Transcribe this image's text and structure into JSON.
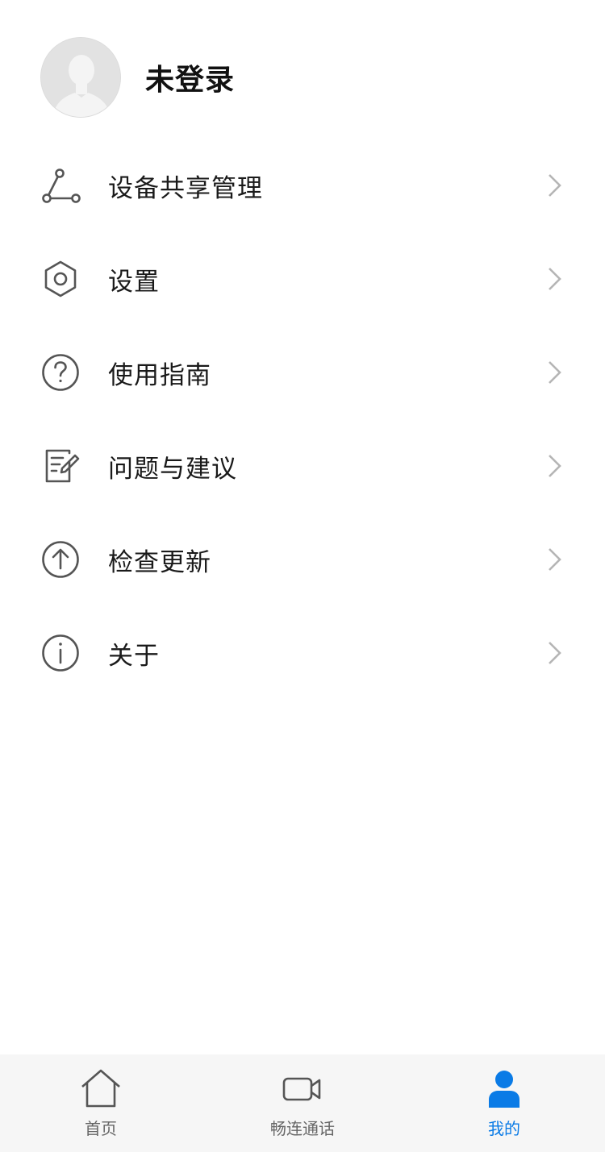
{
  "profile": {
    "name": "未登录",
    "avatar_icon": "default-user-avatar-icon"
  },
  "menu": {
    "items": [
      {
        "label": "设备共享管理",
        "icon": "share-nodes-icon"
      },
      {
        "label": "设置",
        "icon": "gear-icon"
      },
      {
        "label": "使用指南",
        "icon": "help-circle-icon"
      },
      {
        "label": "问题与建议",
        "icon": "feedback-edit-icon"
      },
      {
        "label": "检查更新",
        "icon": "upload-arrow-circle-icon"
      },
      {
        "label": "关于",
        "icon": "info-circle-icon"
      }
    ],
    "chevron_icon": "chevron-right-icon"
  },
  "tabbar": {
    "tabs": [
      {
        "label": "首页",
        "icon": "home-icon",
        "active": false
      },
      {
        "label": "畅连通话",
        "icon": "video-camera-icon",
        "active": false
      },
      {
        "label": "我的",
        "icon": "person-icon",
        "active": true
      }
    ]
  },
  "colors": {
    "accent": "#0a7be6",
    "icon_gray": "#555555",
    "chevron_gray": "#b5b5b5",
    "tabbar_bg": "#f6f6f6"
  }
}
